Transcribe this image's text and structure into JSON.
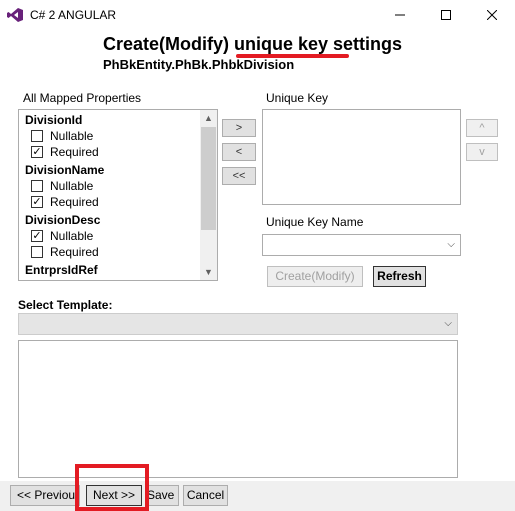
{
  "window": {
    "title": "C# 2 ANGULAR"
  },
  "header": {
    "title": "Create(Modify) unique key settings",
    "subtitle": "PhBkEntity.PhBk.PhbkDivision"
  },
  "colors": {
    "annotation_red": "#e31b23",
    "app_icon_purple": "#68217a"
  },
  "mapped_properties": {
    "label": "All Mapped Properties",
    "groups": [
      {
        "name": "DivisionId",
        "options": [
          {
            "label": "Nullable",
            "checked": false
          },
          {
            "label": "Required",
            "checked": true
          }
        ]
      },
      {
        "name": "DivisionName",
        "options": [
          {
            "label": "Nullable",
            "checked": false
          },
          {
            "label": "Required",
            "checked": true
          }
        ]
      },
      {
        "name": "DivisionDesc",
        "options": [
          {
            "label": "Nullable",
            "checked": true
          },
          {
            "label": "Required",
            "checked": false
          }
        ]
      },
      {
        "name": "EntrprsIdRef",
        "options": []
      }
    ]
  },
  "move_buttons": {
    "add": ">",
    "remove": "<",
    "remove_all": "<<"
  },
  "unique_key": {
    "label": "Unique Key",
    "up": "^",
    "down": "v",
    "name_label": "Unique Key Name",
    "name_value": ""
  },
  "actions": {
    "create_modify": "Create(Modify)",
    "refresh": "Refresh"
  },
  "template": {
    "label": "Select Template:",
    "selected": ""
  },
  "footer": {
    "previous": "<< Previous",
    "next": "Next >>",
    "save": "Save",
    "cancel": "Cancel"
  },
  "icons": {
    "app": "visual-studio-icon",
    "minimize": "minimize-icon",
    "maximize": "maximize-icon",
    "close": "close-icon",
    "check": "✓",
    "dropdown": "⌵"
  }
}
